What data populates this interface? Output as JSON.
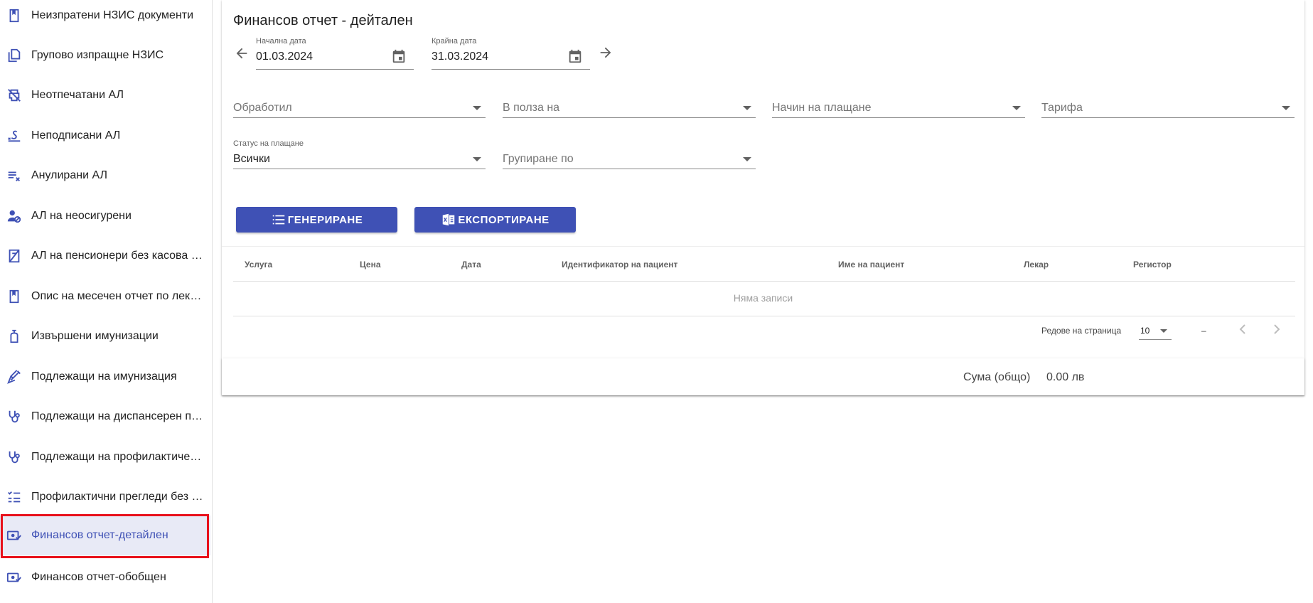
{
  "sidebar": {
    "items": [
      {
        "label": "Неизпратени НЗИС документи",
        "icon": "bookmark-icon"
      },
      {
        "label": "Групово изпращне НЗИС",
        "icon": "copy-icon"
      },
      {
        "label": "Неотпечатани АЛ",
        "icon": "print-disabled-icon"
      },
      {
        "label": "Неподписани АЛ",
        "icon": "signature-icon"
      },
      {
        "label": "Анулирани АЛ",
        "icon": "playlist-remove-icon"
      },
      {
        "label": "АЛ на неосигурени",
        "icon": "person-off-icon"
      },
      {
        "label": "АЛ на пенсионери без касова бележка",
        "icon": "receipt-off-icon"
      },
      {
        "label": "Опис на месечен отчет по лекари",
        "icon": "bookmark-icon"
      },
      {
        "label": "Извършени имунизации",
        "icon": "vaccine-bottle-icon"
      },
      {
        "label": "Подлежащи на имунизация",
        "icon": "syringe-icon"
      },
      {
        "label": "Подлежащи на диспансерен преглед",
        "icon": "stethoscope-icon"
      },
      {
        "label": "Подлежащи на профилактичен преглед",
        "icon": "stethoscope-icon"
      },
      {
        "label": "Профилактични прегледи без резултати",
        "icon": "checklist-icon"
      },
      {
        "label": "Финансов отчет-детайлен",
        "icon": "money-check-icon"
      },
      {
        "label": "Финансов отчет-обобщен",
        "icon": "money-check-icon"
      }
    ],
    "active_index": 13
  },
  "report": {
    "title": "Финансов отчет - дейтален",
    "start_date": {
      "label": "Начална дата",
      "value": "01.03.2024"
    },
    "end_date": {
      "label": "Крайна дата",
      "value": "31.03.2024"
    },
    "filters": {
      "processed_by": "Обработил",
      "in_favor_of": "В полза на",
      "payment_method": "Начин на плащане",
      "tariff": "Тарифа",
      "payment_status_label": "Статус на плащане",
      "payment_status_value": "Всички",
      "group_by": "Групиране по"
    },
    "buttons": {
      "generate": "ГЕНЕРИРАНЕ",
      "export": "ЕКСПОРТИРАНЕ"
    }
  },
  "table": {
    "columns": [
      "Услуга",
      "Цена",
      "Дата",
      "Идентификатор на пациент",
      "Име на пациент",
      "Лекар",
      "Регистор"
    ],
    "empty_text": "Няма записи",
    "rows_per_page_label": "Редове на страница",
    "rows_per_page_value": "10",
    "range_text": "–"
  },
  "summary": {
    "label": "Сума (общо)",
    "value": "0.00 лв"
  },
  "colors": {
    "primary": "#3f51b5",
    "active_bg": "#e8eaf6",
    "highlight": "#e8111b"
  }
}
